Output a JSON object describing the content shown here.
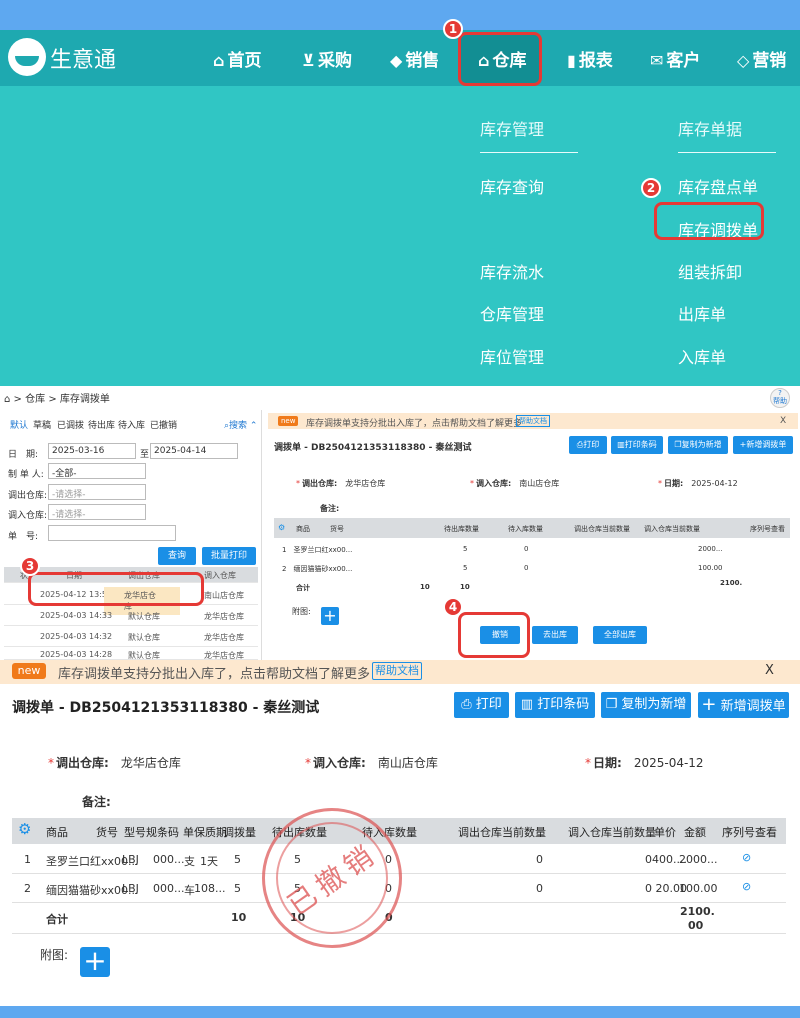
{
  "app": {
    "name": "生意通"
  },
  "nav": [
    {
      "icon": "home-icon",
      "label": "首页"
    },
    {
      "icon": "cart-icon",
      "label": "采购"
    },
    {
      "icon": "tag-icon",
      "label": "销售"
    },
    {
      "icon": "warehouse-icon",
      "label": "仓库"
    },
    {
      "icon": "clipboard-icon",
      "label": "报表"
    },
    {
      "icon": "mail-icon",
      "label": "客户"
    },
    {
      "icon": "marketing-icon",
      "label": "营销"
    }
  ],
  "dropdown": {
    "col1_title": "库存管理",
    "col2_title": "库存单据",
    "col1": [
      "库存查询",
      "库存流水",
      "仓库管理",
      "库位管理"
    ],
    "col2": [
      "库存盘点单",
      "库存调拨单",
      "组装拆卸",
      "出库单",
      "入库单"
    ]
  },
  "steps": [
    "1",
    "2",
    "3",
    "4"
  ],
  "breadcrumb": {
    "home": "⌂",
    "sep": ">",
    "wh": "仓库",
    "page": "库存调拨单"
  },
  "help": "帮助",
  "filter": {
    "tabs": [
      "默认",
      "草稿",
      "已调拨",
      "待出库",
      "待入库",
      "已撤销"
    ],
    "search": "搜索",
    "date_label": "日　期:",
    "date_from": "2025-03-16",
    "to": "至",
    "date_to": "2025-04-14",
    "maker_label": "制 单 人:",
    "maker": "-全部-",
    "out_label": "调出仓库:",
    "out_ph": "-请选择-",
    "in_label": "调入仓库:",
    "in_ph": "-请选择-",
    "no_label": "单　号:",
    "query": "查询",
    "batch_print": "批量打印"
  },
  "list": {
    "headers": [
      "状",
      "日期",
      "调出仓库",
      "调入仓库"
    ],
    "rows": [
      {
        "date": "2025-04-12 13:53",
        "out": "龙华店仓库",
        "in": "南山店仓库"
      },
      {
        "date": "2025-04-03 14:33",
        "out": "默认仓库",
        "in": "龙华店仓库"
      },
      {
        "date": "2025-04-03 14:32",
        "out": "默认仓库",
        "in": "龙华店仓库"
      },
      {
        "date": "2025-04-03 14:28",
        "out": "默认仓库",
        "in": "龙华店仓库"
      }
    ]
  },
  "notice": {
    "new": "new",
    "text": "库存调拨单支持分批出入库了，点击帮助文档了解更多",
    "help": "帮助文档",
    "close": "X"
  },
  "doc": {
    "title": "调拨单 - DB2504121353118380 - 秦丝测试",
    "buttons": {
      "print": "打印",
      "print_code": "打印条码",
      "copy": "复制为新增",
      "new": "新增调拨单"
    },
    "out_label": "调出仓库:",
    "out": "龙华店仓库",
    "in_label": "调入仓库:",
    "in": "南山店仓库",
    "date_label": "日期:",
    "date": "2025-04-12",
    "remark_label": "备注:",
    "headers": [
      "商品",
      "货号",
      "型号规",
      "条码",
      "单",
      "保质期",
      "调拨量",
      "待出库数量",
      "待入库数量",
      "调出仓库当前数量",
      "调入仓库当前数量",
      "单价",
      "金额",
      "序列号查看"
    ],
    "rows": [
      {
        "no": "1",
        "name": "圣罗兰口红xx00...",
        "model": "LBJ",
        "code": "000...",
        "unit": "支",
        "shelf": "1天",
        "qty": "5",
        "wait_out": "5",
        "wait_in": "0",
        "out_now": "0",
        "price": "0400....",
        "amount": "2000..."
      },
      {
        "no": "2",
        "name": "缅因猫猫砂xx00...",
        "model": "LBJ",
        "code": "000...",
        "unit": "车",
        "shelf": "108...",
        "qty": "5",
        "wait_out": "5",
        "wait_in": "0",
        "out_now": "0",
        "price": "0 20.00",
        "amount": "100.00"
      }
    ],
    "total_label": "合计",
    "total_qty": "10",
    "total_out": "10",
    "total_in": "0",
    "total_amount_1": "2100.",
    "total_amount_2": "00",
    "attach_label": "附图:",
    "stamp": "已撤销",
    "actions": {
      "revoke": "撤销",
      "out": "去出库",
      "all_out": "全部出库"
    }
  }
}
